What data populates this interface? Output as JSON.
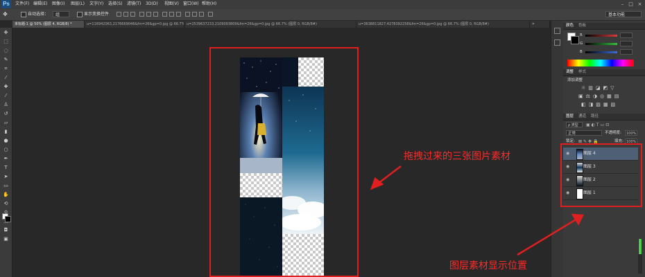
{
  "app": {
    "logo": "Ps",
    "menus": [
      "文件(F)",
      "编辑(E)",
      "图像(I)",
      "图层(L)",
      "文字(Y)",
      "选择(S)",
      "滤镜(T)",
      "3D(D)",
      "视图(V)",
      "窗口(W)",
      "帮助(H)"
    ]
  },
  "options_bar": {
    "auto_select_label": "自动选择：",
    "auto_select_value": "组",
    "show_transform_label": "显示变换控件",
    "workspace": "基本功能"
  },
  "tabs": [
    {
      "label": "未标题-1 @ 50% (图层 4, RGB/8) *",
      "active": true
    },
    {
      "label": "u=116942063,2176669046&fm=26&gp=0.jpg  @  66.7% (图层 0, RGB/8#)",
      "active": false
    },
    {
      "label": "u=2539637233,2109093809&fm=26&gp=0.jpg  @  66.7% (图层 0, RGB/8#)",
      "active": false
    },
    {
      "label": "u=3638811827,4278392258&fm=26&gp=0.jpg  @  66.7% (图层 0, RGB/8#)",
      "active": false
    }
  ],
  "color_panel": {
    "tabs": [
      "颜色",
      "色板"
    ],
    "channels": [
      "R",
      "G",
      "B"
    ],
    "values": [
      "",
      "",
      ""
    ],
    "colors": {
      "r": "#e03a3a",
      "g": "#34c23a",
      "b": "#3a6fe0"
    }
  },
  "adjust_panel": {
    "tabs": [
      "调整",
      "样式"
    ],
    "title": "添加调整"
  },
  "layers_panel": {
    "tabs": [
      "图层",
      "通道",
      "路径"
    ],
    "kind_label": "ρ 类型",
    "blend_mode": "正常",
    "opacity_label": "不透明度:",
    "opacity_value": "100%",
    "lock_label": "锁定:",
    "fill_label": "填充:",
    "fill_value": "100%",
    "layers": [
      {
        "name": "图层 4",
        "selected": true
      },
      {
        "name": "图层 3",
        "selected": false
      },
      {
        "name": "图层 2",
        "selected": false
      },
      {
        "name": "图层 1",
        "selected": false
      }
    ]
  },
  "annotations": {
    "drag_materials": "拖拽过来的三张图片素材",
    "layers_location": "图层素材显示位置",
    "color": "#ff2a2a"
  }
}
